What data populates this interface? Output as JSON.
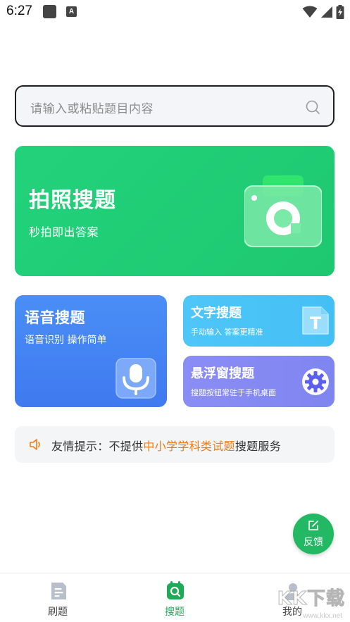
{
  "status_bar": {
    "time": "6:27",
    "notification_letter": "A"
  },
  "search": {
    "placeholder": "请输入或粘贴题目内容"
  },
  "photo_card": {
    "title": "拍照搜题",
    "subtitle": "秒拍即出答案"
  },
  "voice_card": {
    "title": "语音搜题",
    "subtitle": "语音识别 操作简单"
  },
  "text_card": {
    "title": "文字搜题",
    "subtitle": "手动输入 答案更精准",
    "icon_letter": "T"
  },
  "float_card": {
    "title": "悬浮窗搜题",
    "subtitle": "搜题按钮常驻于手机桌面"
  },
  "notice": {
    "prefix": "友情提示：不提供",
    "highlight": "中小学学科类试题",
    "suffix": "搜题服务"
  },
  "feedback": {
    "label": "反馈"
  },
  "tabs": [
    {
      "label": "刷题",
      "active": false
    },
    {
      "label": "搜题",
      "active": true
    },
    {
      "label": "我的",
      "active": false
    }
  ],
  "watermark": {
    "text": "KK下载",
    "url": "www.kkx.net"
  },
  "colors": {
    "green": "#22d27b",
    "blue": "#4a8ef6",
    "cyan": "#4fc6f8",
    "purple": "#8a8df4",
    "highlight": "#f07a14",
    "tab_active": "#1faa58"
  }
}
